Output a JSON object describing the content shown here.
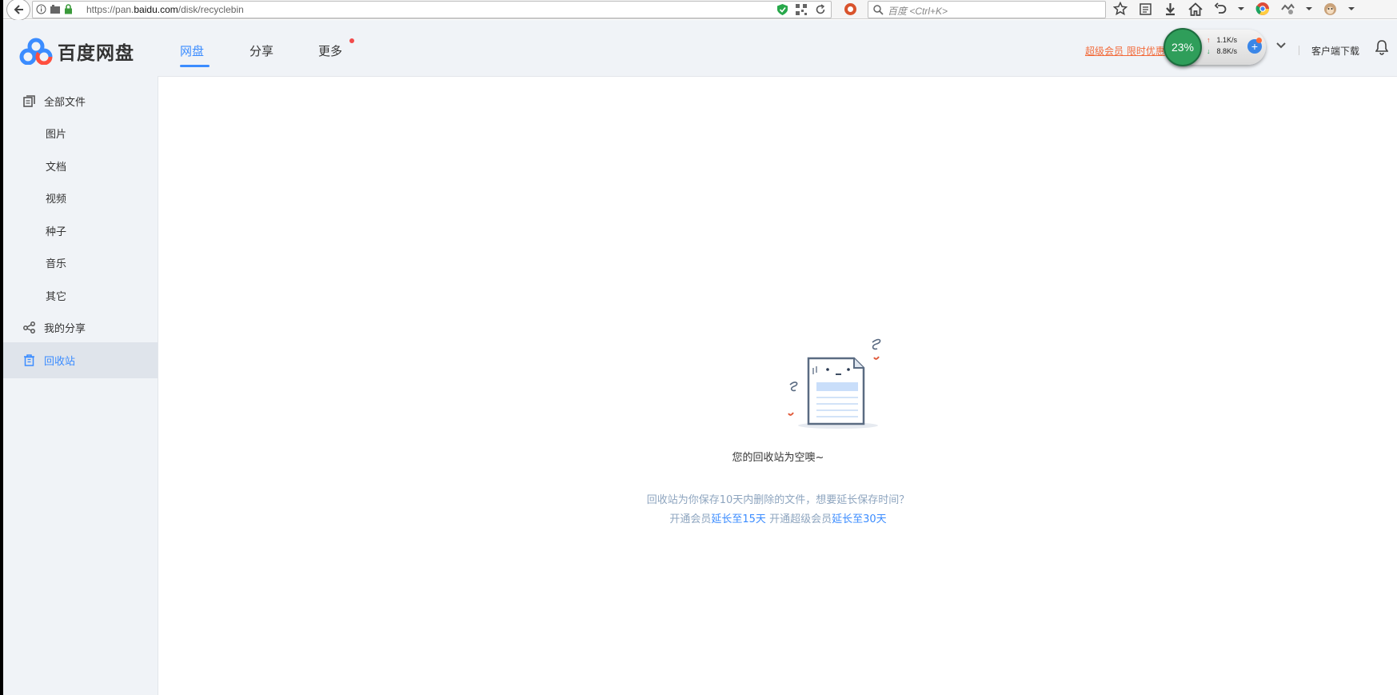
{
  "browser": {
    "url_prefix": "https://pan.",
    "url_domain": "baidu.com",
    "url_path": "/disk/recyclebin",
    "search_placeholder": "百度 <Ctrl+K>"
  },
  "header": {
    "logo_text": "百度网盘",
    "tabs": [
      {
        "label": "网盘",
        "active": true
      },
      {
        "label": "分享",
        "active": false
      },
      {
        "label": "更多",
        "active": false
      }
    ],
    "promo_text": "超级会员 限时优惠",
    "speed": {
      "percent": "23%",
      "upload": "1.1K/s",
      "download": "8.8K/s"
    },
    "client_download": "客户端下载"
  },
  "sidebar": {
    "items": [
      {
        "label": "全部文件",
        "icon": "files-icon"
      },
      {
        "label": "图片"
      },
      {
        "label": "文档"
      },
      {
        "label": "视频"
      },
      {
        "label": "种子"
      },
      {
        "label": "音乐"
      },
      {
        "label": "其它"
      },
      {
        "label": "我的分享",
        "icon": "share-icon"
      },
      {
        "label": "回收站",
        "icon": "trash-icon",
        "selected": true
      }
    ]
  },
  "main": {
    "empty_title": "您的回收站为空噢~",
    "desc_line1": "回收站为你保存10天内删除的文件，想要延长保存时间？",
    "desc_line2_a": "开通会员",
    "desc_line2_b": "延长至15天",
    "desc_line2_c": " 开通超级会员",
    "desc_line2_d": "延长至30天"
  },
  "colors": {
    "accent": "#3b8cff",
    "promo": "#f26a3a",
    "sidebar_bg": "#f0f3f7",
    "speed_green": "#2f9e5a"
  }
}
